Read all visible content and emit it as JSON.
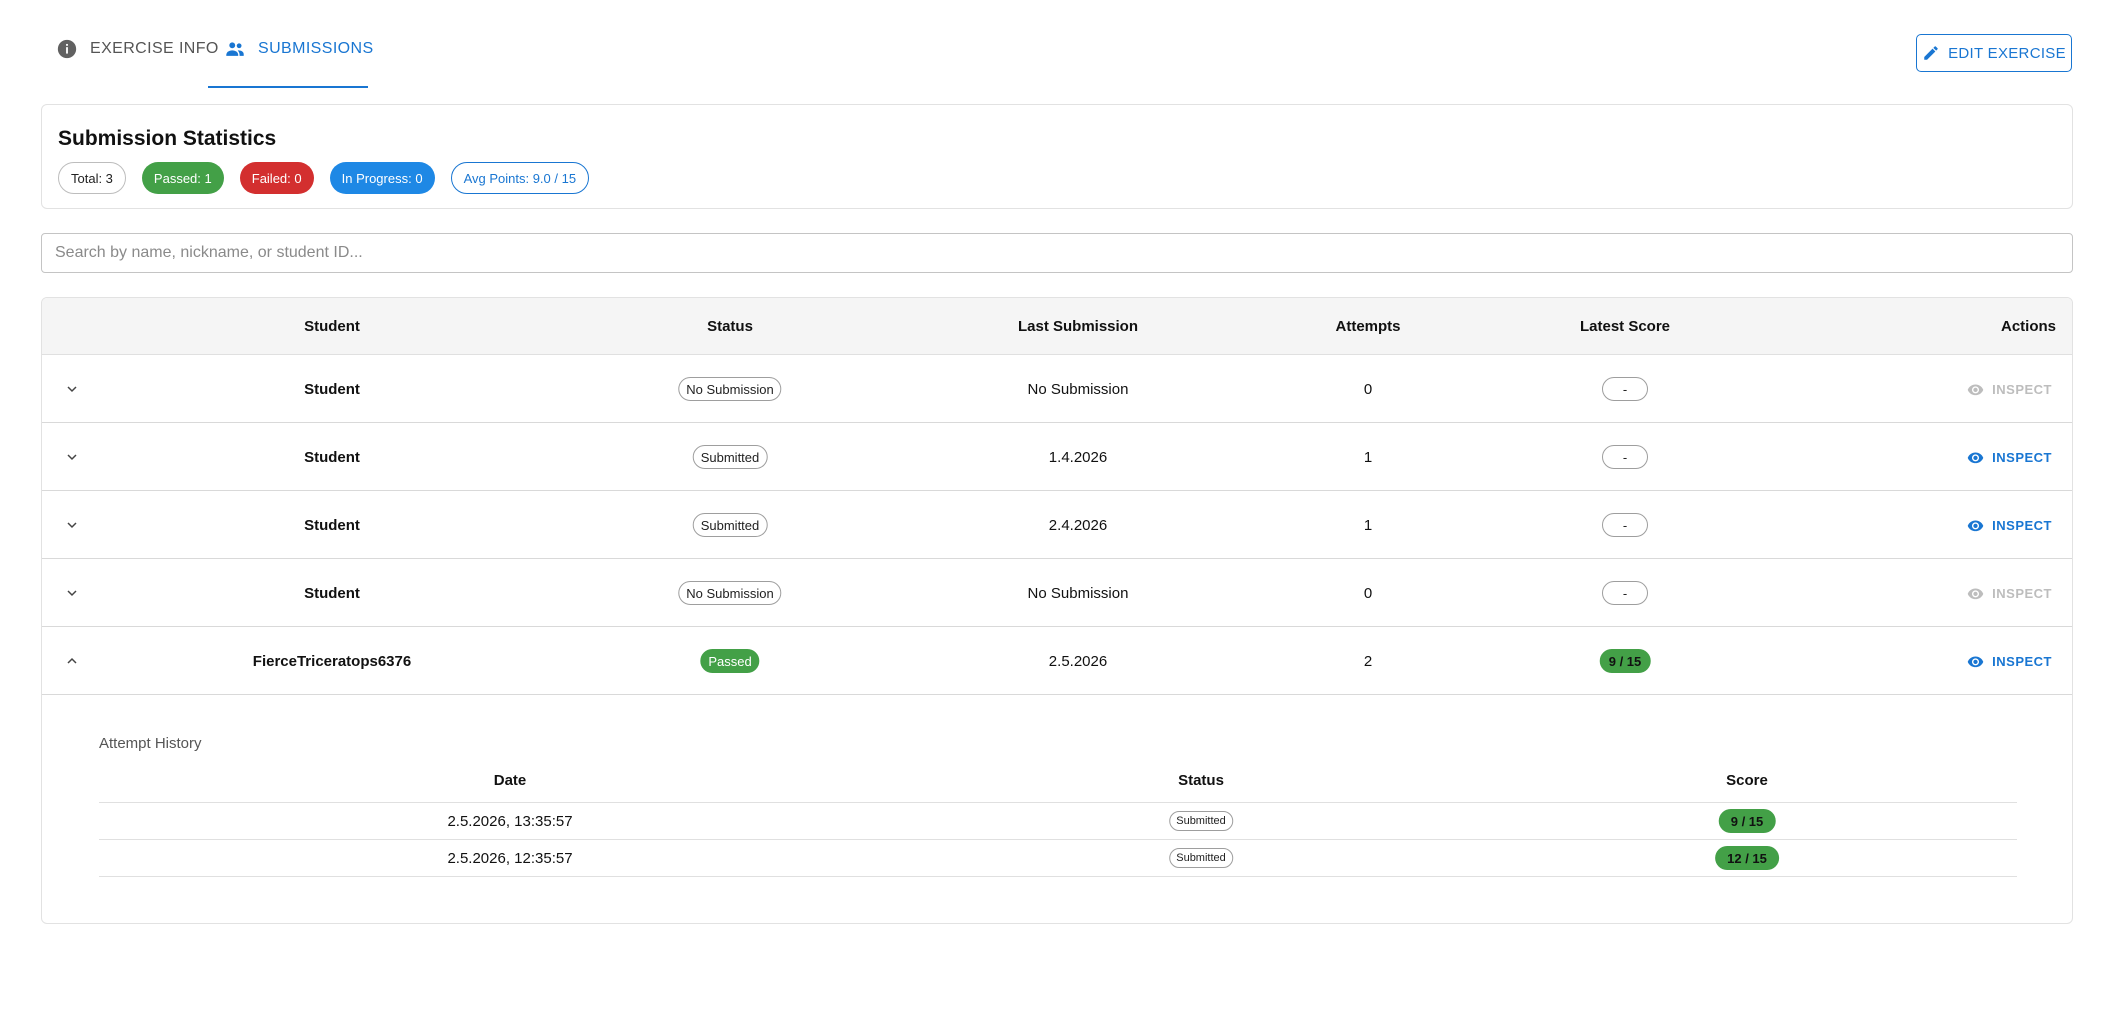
{
  "tabs": {
    "exercise_info": "EXERCISE INFO",
    "submissions": "SUBMISSIONS"
  },
  "edit_button": "EDIT EXERCISE",
  "stats": {
    "title": "Submission Statistics",
    "total": "Total: 3",
    "passed": "Passed: 1",
    "failed": "Failed: 0",
    "in_progress": "In Progress: 0",
    "avg_points": "Avg Points: 9.0 / 15"
  },
  "search": {
    "placeholder": "Search by name, nickname, or student ID...",
    "value": ""
  },
  "table": {
    "headers": {
      "student": "Student",
      "status": "Status",
      "last_submission": "Last Submission",
      "attempts": "Attempts",
      "latest_score": "Latest Score",
      "actions": "Actions"
    },
    "rows": [
      {
        "student": "Student",
        "status": "No Submission",
        "last_submission": "No Submission",
        "attempts": "0",
        "score": "-",
        "action": "INSPECT",
        "inspect_enabled": false,
        "expanded": false
      },
      {
        "student": "Student",
        "status": "Submitted",
        "last_submission": "1.4.2026",
        "attempts": "1",
        "score": "-",
        "action": "INSPECT",
        "inspect_enabled": true,
        "expanded": false
      },
      {
        "student": "Student",
        "status": "Submitted",
        "last_submission": "2.4.2026",
        "attempts": "1",
        "score": "-",
        "action": "INSPECT",
        "inspect_enabled": true,
        "expanded": false
      },
      {
        "student": "Student",
        "status": "No Submission",
        "last_submission": "No Submission",
        "attempts": "0",
        "score": "-",
        "action": "INSPECT",
        "inspect_enabled": false,
        "expanded": false
      },
      {
        "student": "FierceTriceratops6376",
        "status": "Passed",
        "last_submission": "2.5.2026",
        "attempts": "2",
        "score": "9 / 15",
        "action": "INSPECT",
        "inspect_enabled": true,
        "expanded": true
      }
    ]
  },
  "history": {
    "title": "Attempt History",
    "headers": {
      "date": "Date",
      "status": "Status",
      "score": "Score"
    },
    "rows": [
      {
        "date": "2.5.2026, 13:35:57",
        "status": "Submitted",
        "score": "9 / 15"
      },
      {
        "date": "2.5.2026, 12:35:57",
        "status": "Submitted",
        "score": "12 / 15"
      }
    ]
  },
  "colors": {
    "primary": "#1976d2",
    "success": "#43a047",
    "error": "#d32f2f",
    "info": "#1e88e5",
    "disabled": "#bdbdbd"
  },
  "icons": {
    "exercise_info": "info-icon",
    "submissions": "people-icon",
    "edit": "pencil-icon",
    "inspect": "eye-icon",
    "expand": "chevron-down-icon",
    "collapse": "chevron-up-icon"
  }
}
